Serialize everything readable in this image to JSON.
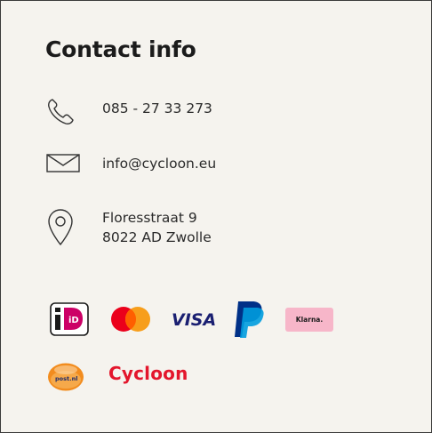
{
  "contact": {
    "title": "Contact info",
    "phone": "085 - 27 33 273",
    "email": "info@cycloon.eu",
    "address_line1": "Floresstraat 9",
    "address_line2": "8022 AD Zwolle"
  },
  "payment_methods": {
    "ideal": "iD",
    "visa": "VISA",
    "klarna": "Klarna.",
    "postnl": "post.nl",
    "cycloon": "Cycloon"
  },
  "colors": {
    "background": "#f5f3ee",
    "border": "#3a3a3a",
    "ideal_pink": "#cc0066",
    "mastercard_red": "#eb001b",
    "mastercard_orange": "#f79e1b",
    "visa_blue": "#1a1f71",
    "paypal_dark": "#003087",
    "paypal_light": "#009cde",
    "klarna_pink": "#f7b6c9",
    "postnl_orange": "#f28c1e",
    "cycloon_red": "#e3162c"
  },
  "icons": [
    "phone-icon",
    "envelope-icon",
    "location-pin-icon"
  ]
}
